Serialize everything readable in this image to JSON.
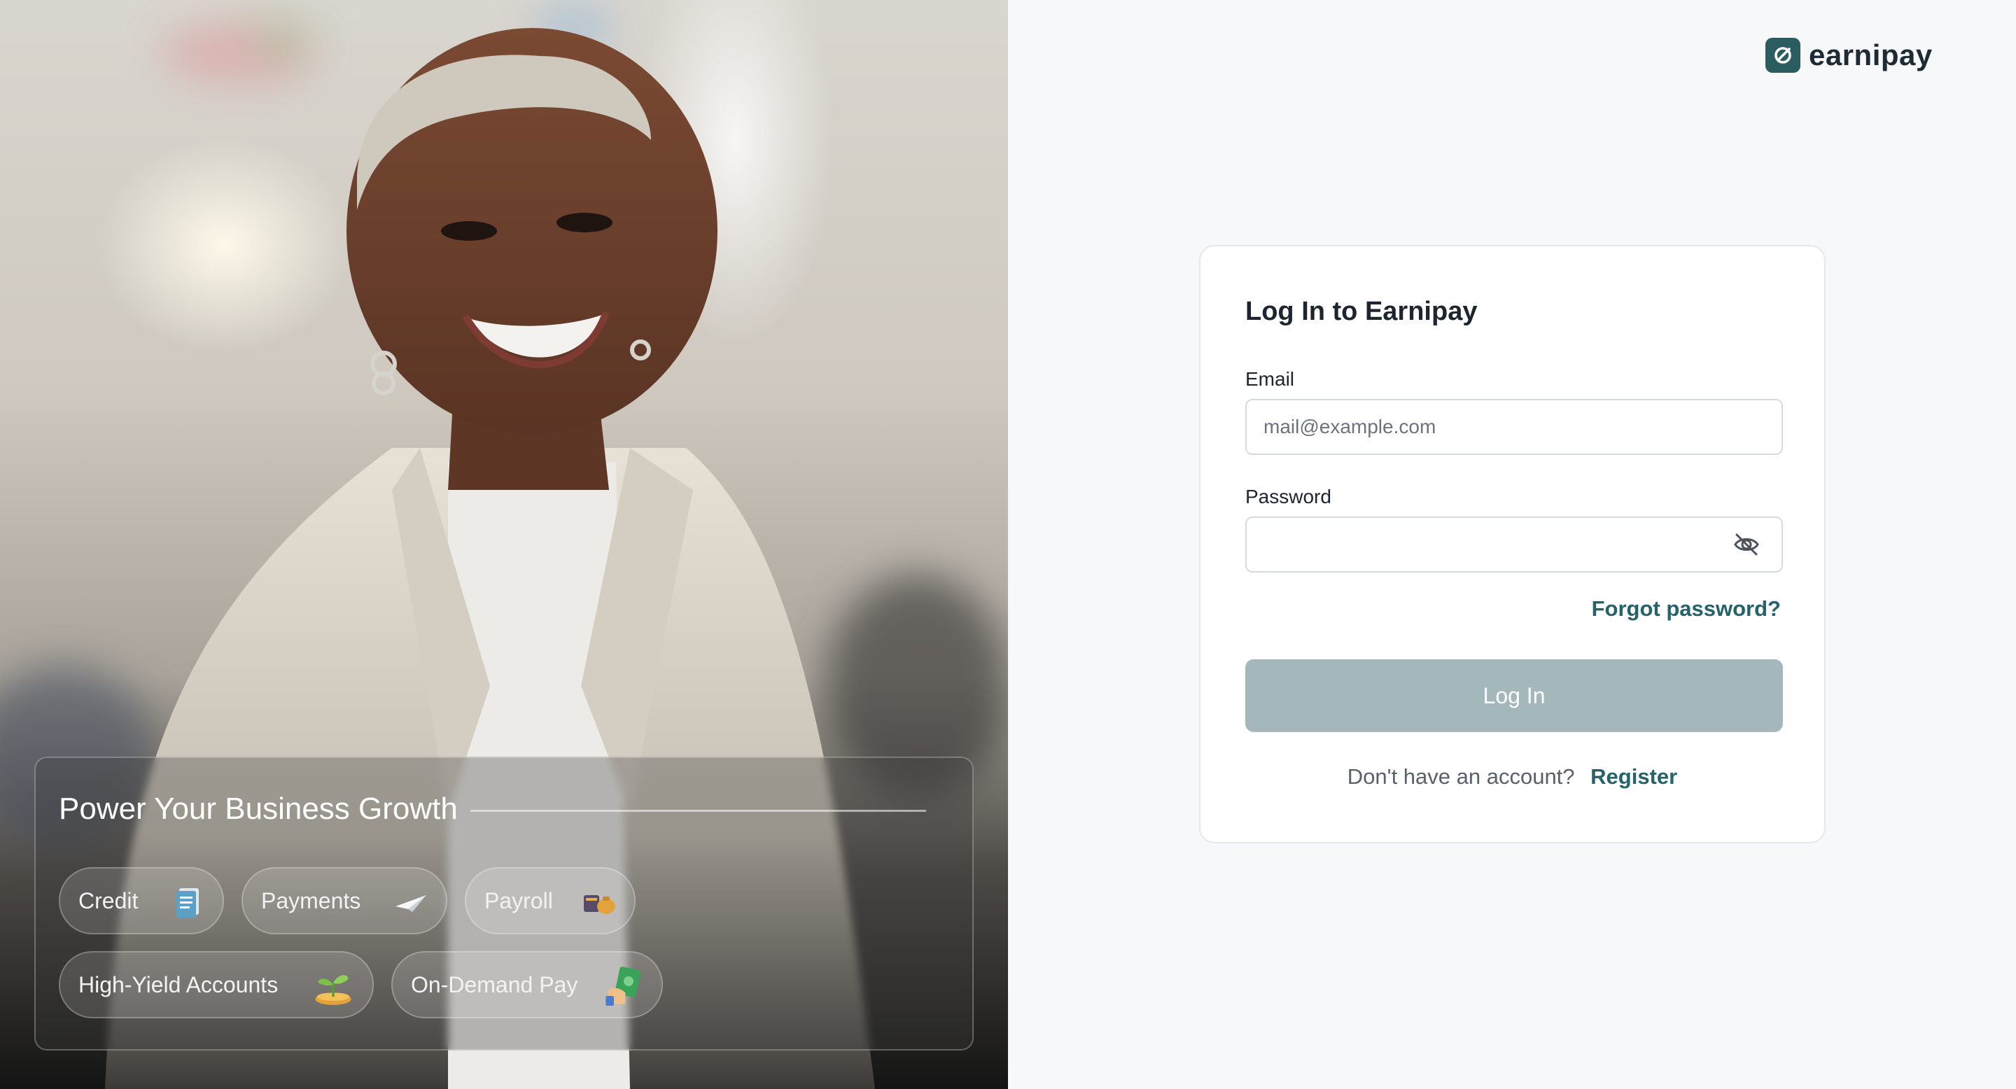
{
  "hero": {
    "title": "Power Your Business Growth",
    "chips": [
      {
        "label": "Credit",
        "icon": "document-icon"
      },
      {
        "label": "Payments",
        "icon": "paper-plane-icon"
      },
      {
        "label": "Payroll",
        "icon": "money-bag-icon"
      },
      {
        "label": "High-Yield Accounts",
        "icon": "sprout-icon"
      },
      {
        "label": "On-Demand Pay",
        "icon": "cash-hand-icon"
      }
    ]
  },
  "brand": {
    "name": "earnipay",
    "accent": "#2b5c60",
    "link_color": "#26626a",
    "button_disabled_color": "#a4b7ba"
  },
  "login": {
    "title": "Log In to Earnipay",
    "email_label": "Email",
    "email_placeholder": "mail@example.com",
    "email_value": "",
    "password_label": "Password",
    "password_value": "",
    "forgot_link": "Forgot password?",
    "submit_label": "Log In",
    "signup_prompt": "Don't have an account?",
    "signup_link": "Register"
  }
}
